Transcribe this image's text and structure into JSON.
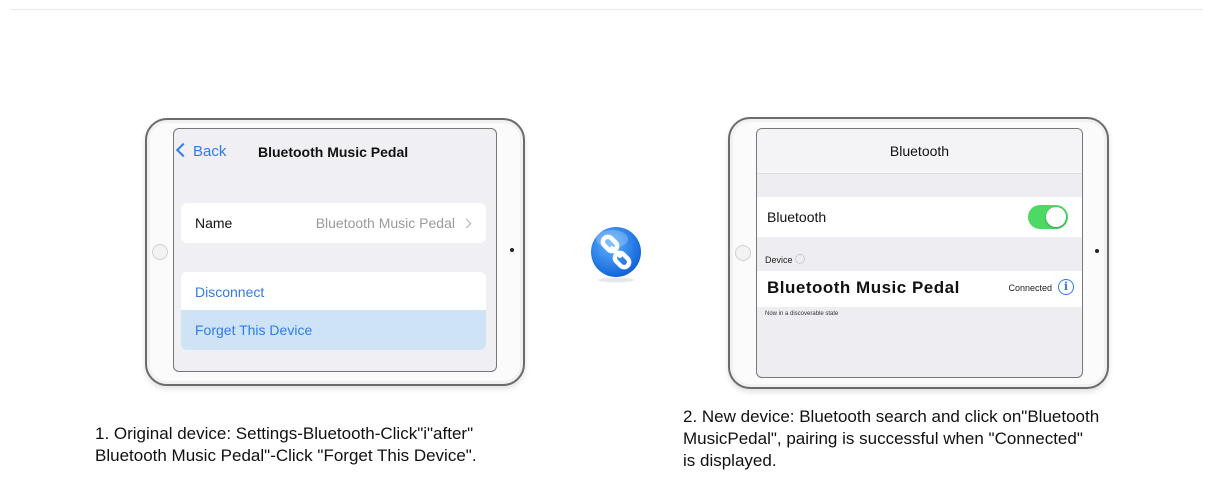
{
  "left_screen": {
    "back_label": "Back",
    "title": "Bluetooth Music Pedal",
    "name_label": "Name",
    "name_value": "Bluetooth Music Pedal",
    "disconnect_label": "Disconnect",
    "forget_label": "Forget This Device"
  },
  "right_screen": {
    "title": "Bluetooth",
    "bluetooth_label": "Bluetooth",
    "bluetooth_on": true,
    "device_header": "Device",
    "device_name": "Bluetooth Music Pedal",
    "device_status": "Connected",
    "discoverable_note": "Now in a discoverable state",
    "toggle_color": "#4cd964"
  },
  "icons": {
    "link": "link-icon",
    "info": "info-icon",
    "back": "chevron-left-icon"
  },
  "accent_color": "#2f7be8",
  "captions": {
    "step1_line1": "1. Original device: Settings-Bluetooth-Click\"i\"after\"",
    "step1_line2": "Bluetooth Music Pedal\"-Click \"Forget This Device\".",
    "step2_line1": "2. New device: Bluetooth search and click on\"Bluetooth",
    "step2_line2": "MusicPedal\", pairing is successful when \"Connected\"",
    "step2_line3": "is displayed."
  }
}
